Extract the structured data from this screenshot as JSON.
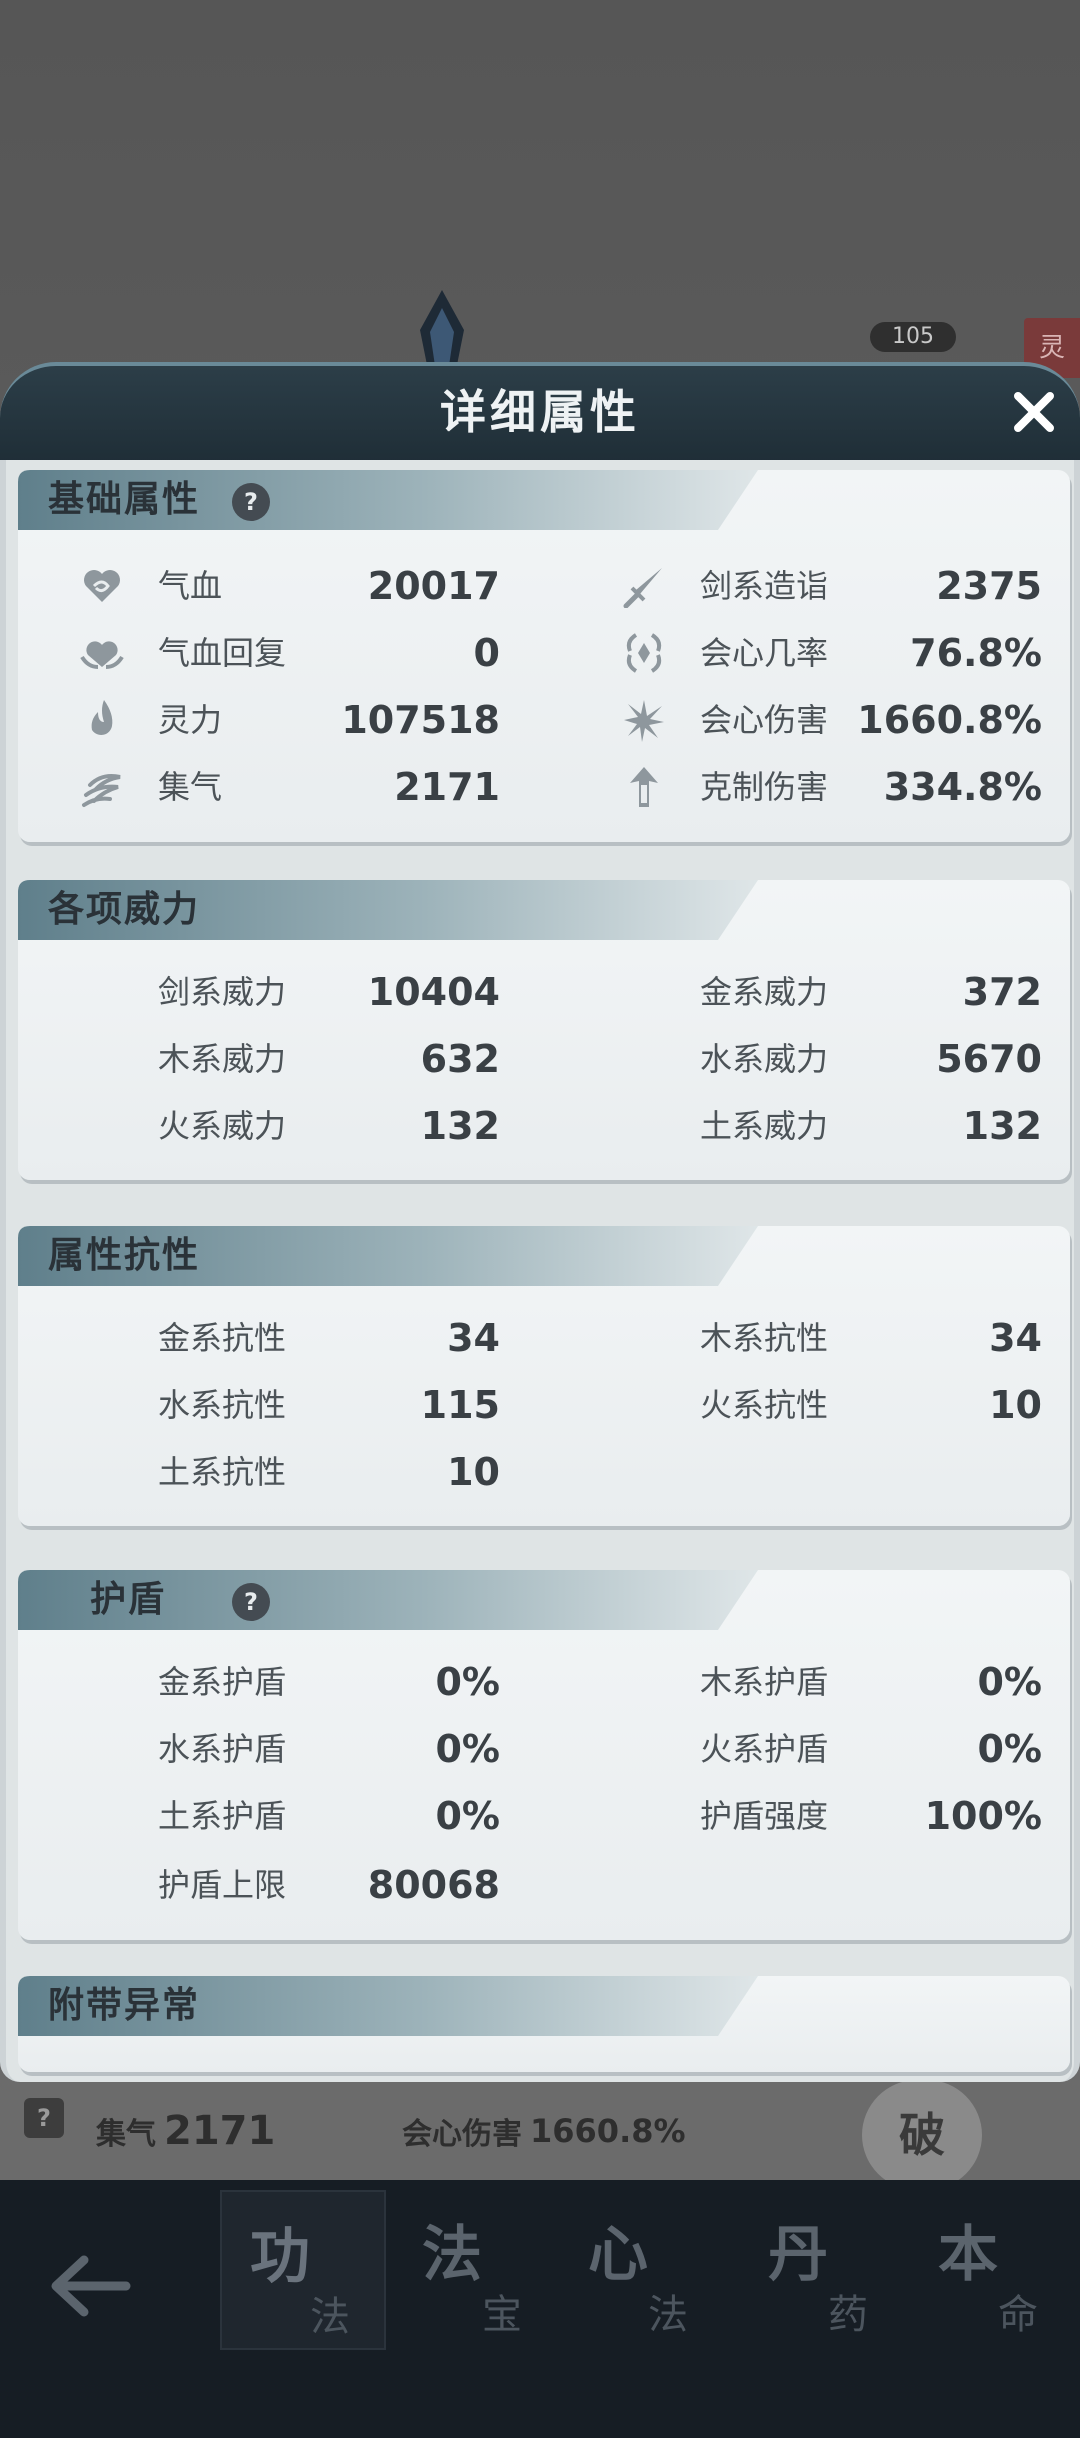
{
  "dialog": {
    "title": "详细属性"
  },
  "sections": {
    "basic": {
      "title": "基础属性",
      "help": "?",
      "left": [
        {
          "icon": "heart-icon",
          "label": "气血",
          "value": "20017"
        },
        {
          "icon": "heart-regen-icon",
          "label": "气血回复",
          "value": "0"
        },
        {
          "icon": "spirit-flame-icon",
          "label": "灵力",
          "value": "107518"
        },
        {
          "icon": "swirl-icon",
          "label": "集气",
          "value": "2171"
        }
      ],
      "right": [
        {
          "icon": "sword-icon",
          "label": "剑系造诣",
          "value": "2375"
        },
        {
          "icon": "crit-rate-icon",
          "label": "会心几率",
          "value": "76.8%"
        },
        {
          "icon": "crit-damage-icon",
          "label": "会心伤害",
          "value": "1660.8%"
        },
        {
          "icon": "restrain-icon",
          "label": "克制伤害",
          "value": "334.8%"
        }
      ]
    },
    "power": {
      "title": "各项威力",
      "left": [
        {
          "label": "剑系威力",
          "value": "10404"
        },
        {
          "label": "木系威力",
          "value": "632"
        },
        {
          "label": "火系威力",
          "value": "132"
        }
      ],
      "right": [
        {
          "label": "金系威力",
          "value": "372"
        },
        {
          "label": "水系威力",
          "value": "5670"
        },
        {
          "label": "土系威力",
          "value": "132"
        }
      ]
    },
    "resist": {
      "title": "属性抗性",
      "left": [
        {
          "label": "金系抗性",
          "value": "34"
        },
        {
          "label": "水系抗性",
          "value": "115"
        },
        {
          "label": "土系抗性",
          "value": "10"
        }
      ],
      "right": [
        {
          "label": "木系抗性",
          "value": "34"
        },
        {
          "label": "火系抗性",
          "value": "10"
        }
      ]
    },
    "shield": {
      "title": "护盾",
      "help": "?",
      "left": [
        {
          "label": "金系护盾",
          "value": "0%"
        },
        {
          "label": "水系护盾",
          "value": "0%"
        },
        {
          "label": "土系护盾",
          "value": "0%"
        },
        {
          "label": "护盾上限",
          "value": "80068"
        }
      ],
      "right": [
        {
          "label": "木系护盾",
          "value": "0%"
        },
        {
          "label": "火系护盾",
          "value": "0%"
        },
        {
          "label": "护盾强度",
          "value": "100%"
        }
      ]
    },
    "abnormal": {
      "title": "附带异常"
    }
  },
  "background": {
    "level": "105",
    "seal": "灵",
    "help": "?",
    "stat1": {
      "label": "集气",
      "value": "2171"
    },
    "stat2": {
      "label": "会心伤害",
      "value": "1660.8%"
    },
    "po": "破"
  },
  "bottom_nav": {
    "tabs": [
      {
        "big": "功",
        "small": "法"
      },
      {
        "big": "法",
        "small": "宝"
      },
      {
        "big": "心",
        "small": "法"
      },
      {
        "big": "丹",
        "small": "药"
      },
      {
        "big": "本",
        "small": "命"
      }
    ]
  },
  "colors": {
    "header": "#1f2e37",
    "panel": "#f2f5f6",
    "tab_bar": "#6e8c98",
    "nav_bg": "#161d24"
  }
}
